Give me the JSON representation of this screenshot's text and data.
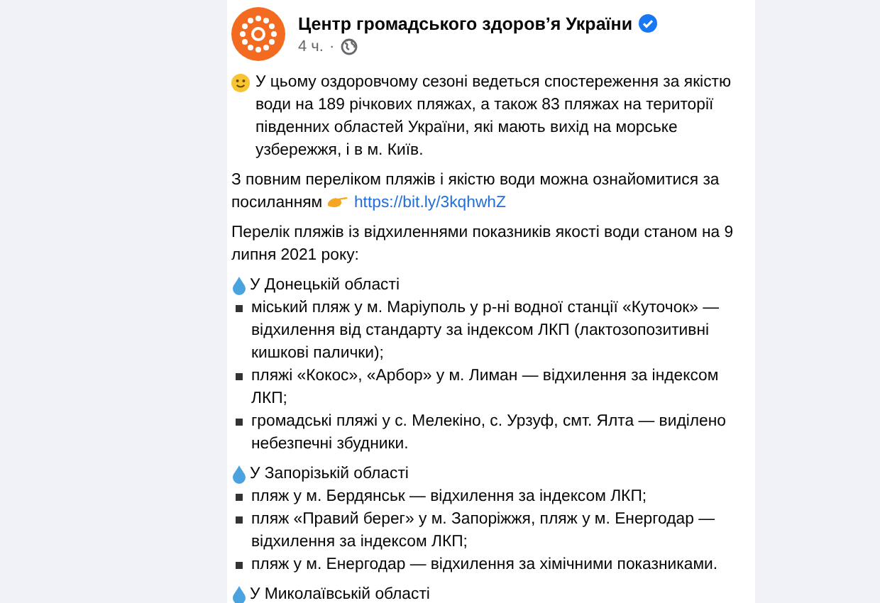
{
  "post": {
    "author": "Центр громадського здоров’я України",
    "verified": true,
    "time": "4 ч.",
    "dot": "·"
  },
  "blocks": [
    {
      "kind": "intro",
      "text": "У цьому оздоровчому сезоні ведеться спостереження за якістю води на 189 річкових пляжах, а також 83 пляжах на території південних областей України, які мають вихід на морське узбережжя, і в м. Київ."
    },
    {
      "kind": "link",
      "text": "З повним переліком пляжів і якістю води можна ознайомитися за посиланням",
      "link": "https://bit.ly/3kqhwhZ"
    },
    {
      "kind": "paragraph",
      "text": "Перелік пляжів із відхиленнями показників якості води станом на 9 липня 2021 року:"
    },
    {
      "kind": "region",
      "heading": "У Донецькій області",
      "items": [
        "міський пляж у м. Маріуполь у р-ні водної станції «Куточок» — відхилення від стандарту за індексом ЛКП (лактозопозитивні кишкові палички);",
        "пляжі «Кокос», «Арбор» у м. Лиман — відхилення за індексом ЛКП;",
        "громадські пляжі у с. Мелекіно, с. Урзуф, смт. Ялта — виділено небезпечні збудники."
      ]
    },
    {
      "kind": "region",
      "heading": "У Запорізькій області",
      "items": [
        "пляж у м. Бердянськ — відхилення за індексом ЛКП;",
        "пляж «Правий берег» у м. Запоріжжя, пляж у м. Енергодар — відхилення за індексом ЛКП;",
        "пляж у м. Енергодар — відхилення за хімічними показниками."
      ]
    },
    {
      "kind": "region",
      "heading": "У Миколаївській області"
    }
  ]
}
